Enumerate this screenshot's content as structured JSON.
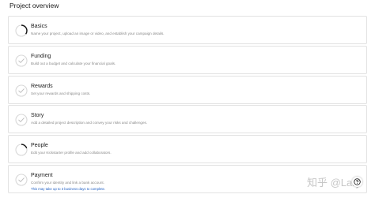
{
  "overview": {
    "title": "Project overview"
  },
  "sections": [
    {
      "title": "Basics",
      "description": "Name your project, upload an image or video, and establish your campaign details.",
      "progress": 0.35
    },
    {
      "title": "Funding",
      "description": "Build out a budget and calculate your financial goals.",
      "progress": 0
    },
    {
      "title": "Rewards",
      "description": "Set your rewards and shipping costs.",
      "progress": 0
    },
    {
      "title": "Story",
      "description": "Add a detailed project description and convey your risks and challenges.",
      "progress": 0
    },
    {
      "title": "People",
      "description": "Edit your Kickstarter profile and add collaborators.",
      "progress": 0.2
    },
    {
      "title": "Payment",
      "description": "Confirm your identity and link a bank account.",
      "note": "This may take up to 3 business days to complete.",
      "progress": 0
    }
  ],
  "watermark": "知乎 @Lary",
  "help": {
    "icon": "help-icon"
  },
  "colors": {
    "progress_track": "#d8d8d8",
    "progress_fill": "#111111",
    "checkmark": "#bdbdbd",
    "note": "#1f5fc4"
  }
}
